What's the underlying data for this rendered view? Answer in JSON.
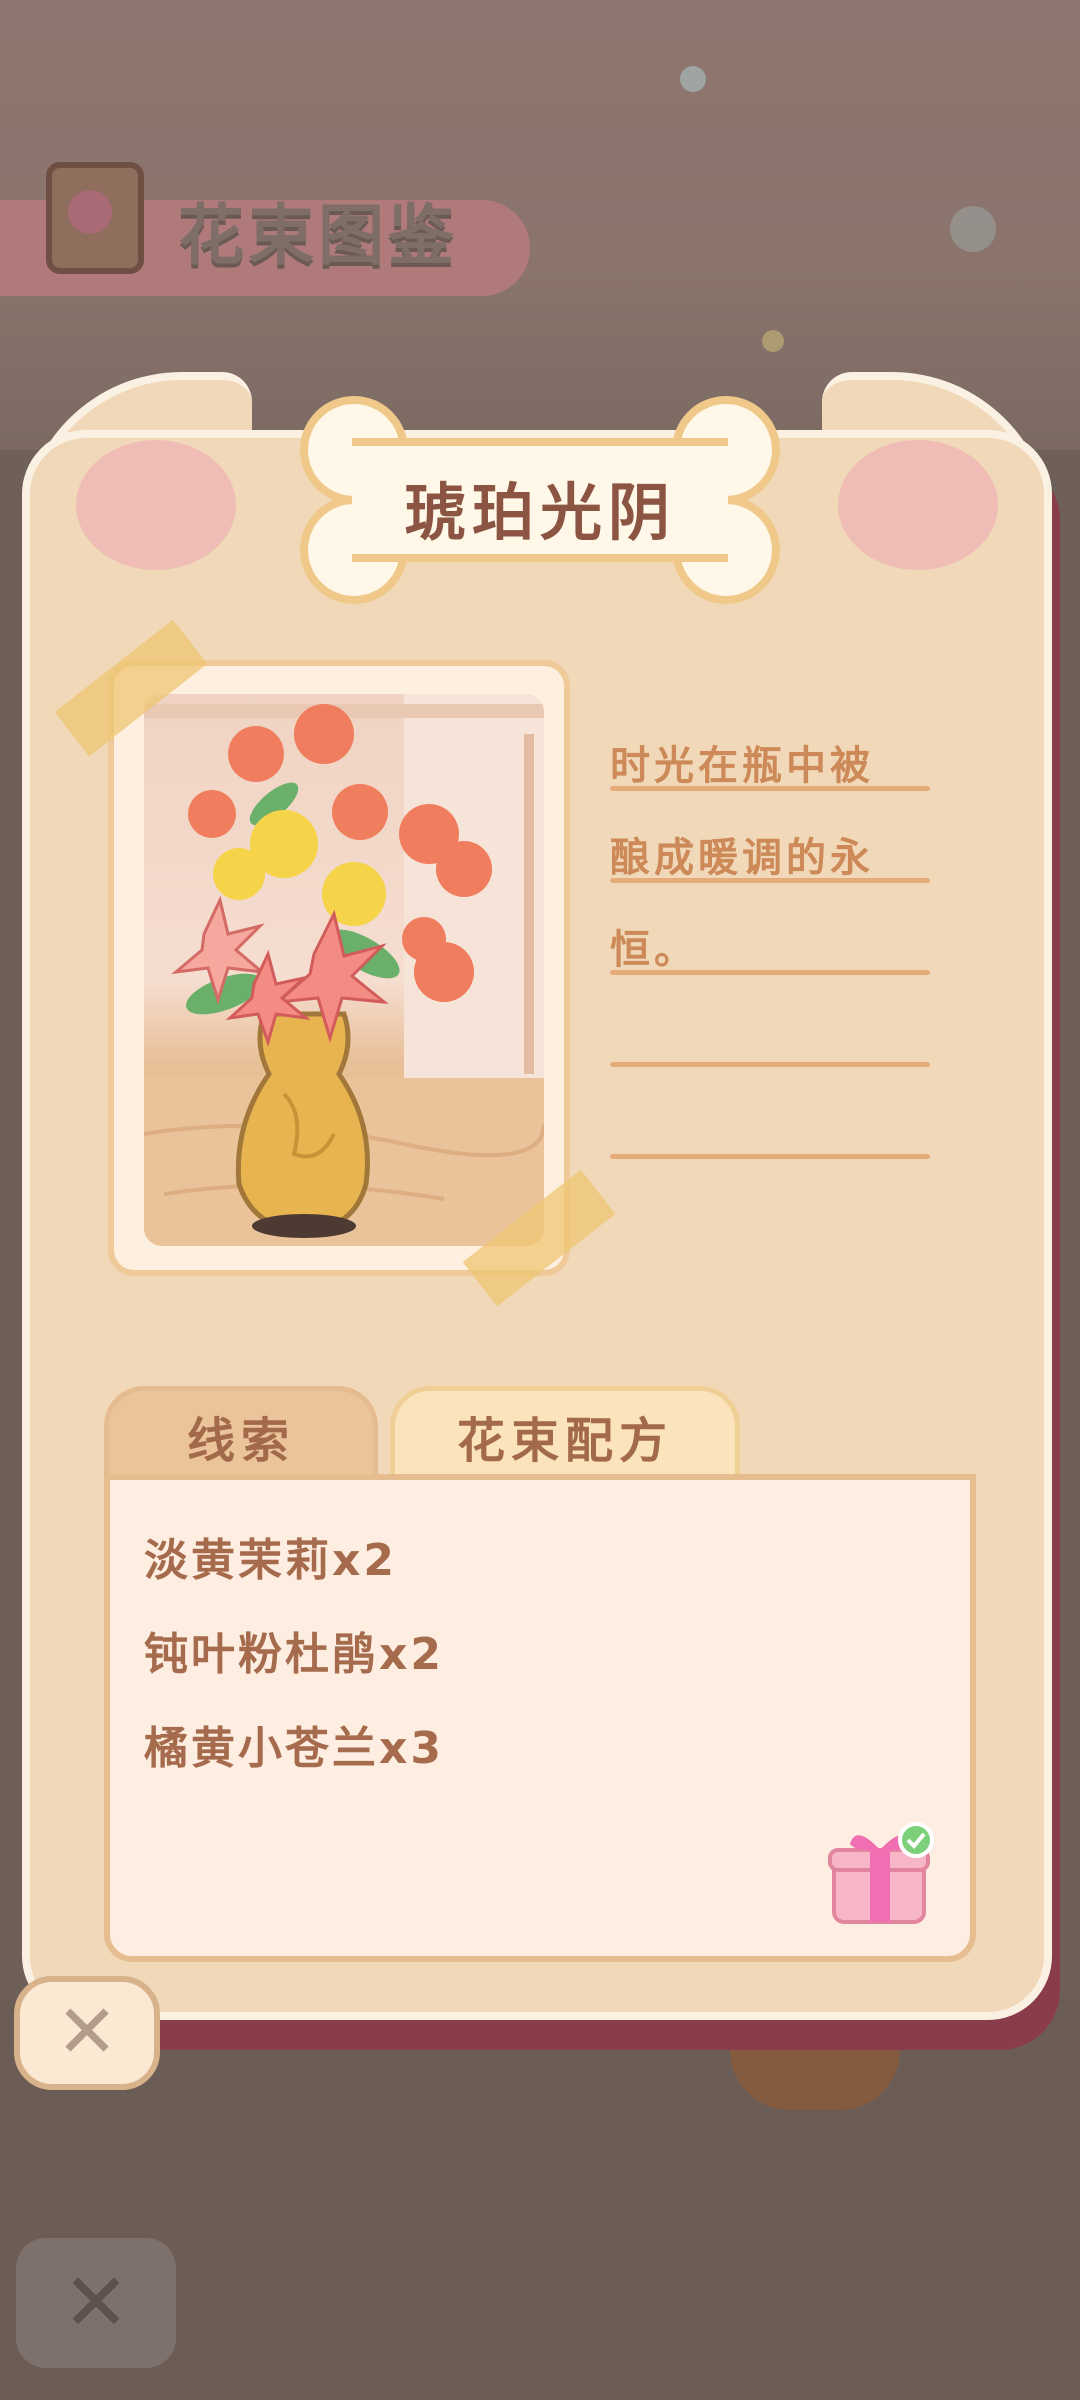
{
  "background": {
    "screen_title": "花束图鉴"
  },
  "card": {
    "title": "琥珀光阴",
    "description": "时光在瓶中被酿成暖调的永恒。",
    "description_lines": [
      "时光在瓶中被",
      "酿成暖调的永",
      "恒。",
      "",
      ""
    ],
    "photo_subject": "amber-vase-bouquet"
  },
  "tabs": [
    {
      "label": "线索",
      "active": false
    },
    {
      "label": "花束配方",
      "active": true
    }
  ],
  "recipe": {
    "ingredients": [
      "淡黄茉莉x2",
      "钝叶粉杜鹃x2",
      "橘黄小苍兰x3"
    ],
    "reward_claimed": true
  },
  "icons": {
    "close": "close-icon",
    "gift": "gift-icon",
    "book": "book-icon"
  },
  "colors": {
    "card_bg": "#f0d8b8",
    "title_text": "#8c5442",
    "desc_text": "#cd8a58",
    "ingredient_text": "#a56b4c",
    "accent_pink": "#f0bdb6"
  }
}
